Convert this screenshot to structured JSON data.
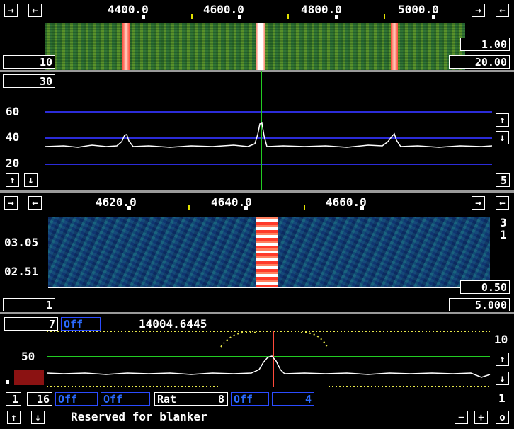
{
  "top_panel": {
    "freq_ticks": [
      "4400.0",
      "4600.0",
      "4800.0",
      "5000.0"
    ],
    "value_left": "10",
    "value_right_top": "1.00",
    "value_right_bottom": "20.00",
    "spectrum_top_value": "30",
    "y_labels": [
      "60",
      "40",
      "20"
    ],
    "right_step_value": "5"
  },
  "mid_panel": {
    "freq_ticks": [
      "4620.0",
      "4640.0",
      "4660.0"
    ],
    "time_labels": [
      "03.05",
      "02.51"
    ],
    "right_small_top": "3",
    "right_small_bottom": "1",
    "value_left": "1",
    "value_right_top": "0.50",
    "value_right_bottom": "5.000"
  },
  "bottom_panel": {
    "left_value": "7",
    "off_label": "Off",
    "frequency_readout": "14004.6445",
    "y_label": "50",
    "right_top_value": "10",
    "right_bottom_value": "1"
  },
  "control_row": {
    "left_num": "1",
    "box_16": "16",
    "off1": "Off",
    "off2": "Off",
    "rat_label": "Rat",
    "rat_value": "8",
    "off3": "Off",
    "value_4": "4",
    "status_text": "Reserved for blanker",
    "minus": "−",
    "plus": "+",
    "o_label": "o"
  },
  "glyphs": {
    "right_arrow": "→",
    "left_arrow": "←",
    "up_arrow": "↑",
    "down_arrow": "↓"
  },
  "colors": {
    "white": "#ffffff",
    "blue_line": "#2b2bd8",
    "green_line": "#22cc22",
    "red_marker": "#ff4a3a",
    "yellow_dots": "#e8e84a",
    "dark_red_box": "#8b1212"
  }
}
